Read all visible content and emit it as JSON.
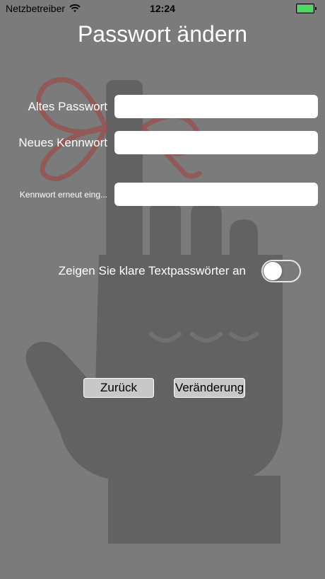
{
  "status_bar": {
    "carrier": "Netzbetreiber",
    "time": "12:24",
    "wifi_icon": "wifi-icon",
    "battery_icon": "battery-icon",
    "battery_level": 1.0,
    "battery_color": "#4cd964"
  },
  "title": "Passwort ändern",
  "fields": {
    "old_password": {
      "label": "Altes Passwort",
      "value": ""
    },
    "new_password": {
      "label": "Neues Kennwort",
      "value": ""
    },
    "confirm_password": {
      "label": "Kennwort erneut eing...",
      "value": ""
    }
  },
  "toggle": {
    "label": "Zeigen Sie klare Textpasswörter an",
    "on": false
  },
  "buttons": {
    "back_label": "Zurück",
    "change_label": "Veränderung"
  },
  "colors": {
    "background": "#7b7b7b",
    "art": "#5f5f5f",
    "ribbon": "#9a4e4e"
  }
}
